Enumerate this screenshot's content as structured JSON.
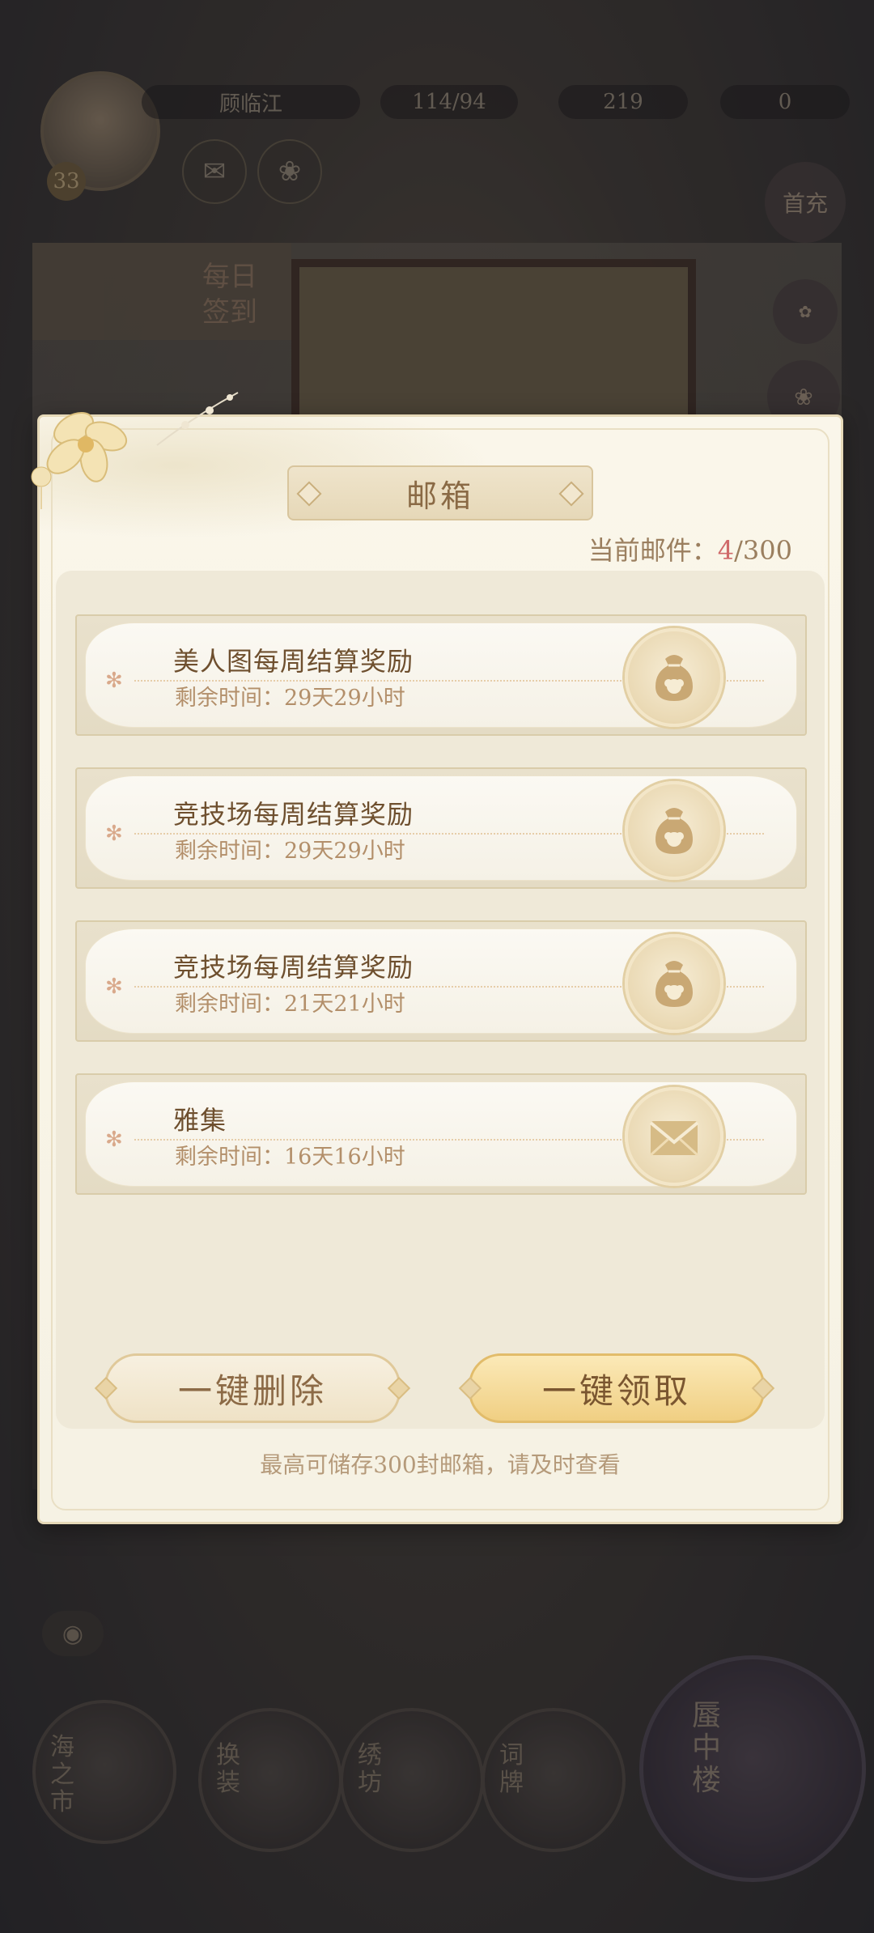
{
  "hud": {
    "player_name": "顾临江",
    "level": "33",
    "stamina": "114/94",
    "coins": "219",
    "gems": "0",
    "first_recharge_label": "首充",
    "checkin_label_1": "每日",
    "checkin_label_2": "签到"
  },
  "dock": [
    {
      "label": "海之市"
    },
    {
      "label": "换装"
    },
    {
      "label": "绣坊"
    },
    {
      "label": "词牌"
    },
    {
      "label": "蜃中楼"
    }
  ],
  "mailbox": {
    "title": "邮箱",
    "count_prefix": "当前邮件：",
    "count_current": "4",
    "count_max": "/300",
    "items": [
      {
        "title": "美人图每周结算奖励",
        "time": "剩余时间：29天29小时",
        "icon": "reward-bag-icon"
      },
      {
        "title": "竞技场每周结算奖励",
        "time": "剩余时间：29天29小时",
        "icon": "reward-bag-icon"
      },
      {
        "title": "竞技场每周结算奖励",
        "time": "剩余时间：21天21小时",
        "icon": "reward-bag-icon"
      },
      {
        "title": "雅集",
        "time": "剩余时间：16天16小时",
        "icon": "envelope-icon"
      }
    ],
    "delete_all_label": "一键删除",
    "claim_all_label": "一键领取",
    "footer_note": "最高可储存300封邮箱，请及时查看"
  },
  "colors": {
    "accent_gold": "#f0cf83",
    "title_brown": "#6e4f2e",
    "count_red": "#d06a6a"
  }
}
